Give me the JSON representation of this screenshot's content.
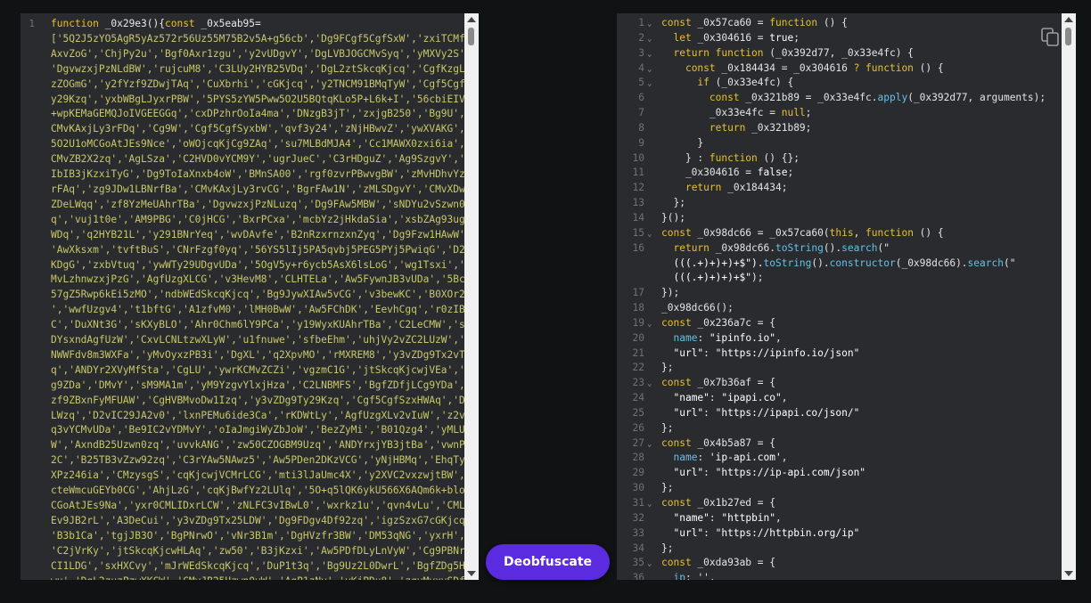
{
  "left_editor": {
    "line_number": "1",
    "lines": [
      "function _0x29e3(){const _0x5eab95=",
      "['5Q2J5zYO5AgR5yAz572r56Uz55M75B2v5A+g56cb','Dg9FCgf5CgfSxW','zxiTCMfK",
      "AxvZoG','ChjPy2u','Bgf0Axr1zgu','y2vUDgvY','DgLVBJOGCMvSyq','yMXVy2S'",
      "'DgvwzxjPzNLdBW','rujcuM8','C3LUy2HYB25VDq','DgL2ztSkcqKjcq','CgfKzgLU",
      "zZOGmG','y2fYzf9ZDwjTAq','CuXbrhi','cGKjcq','y2TNCM91BMqTyW','Cgf5CgfS",
      "y29Kzq','yxbWBgLJyxrPBW','5PYS5zYW5Pww5O2U5BQtqKLo5P+L6k+I','56cbiEIVT",
      "+wpKEMaGEMQJoIVGEEGGq','cxDPzhrOoIa4ma','DNzgB3jT','zxjgB250','Bg9U',",
      "CMvKAxjLy3rFDq','Cg9W','Cgf5CgfSyxbW','qvf3y24','zNjHBwvZ','ywXVAKG',",
      "5O2U1oMCGoAtJEs9Nce','oWOjcqKjCg9ZAq','su7MLBdMJA4','Cc1MAWX0zxi6ia','",
      "CMvZB2X2zq','AgLSza','C2HVD0vYCM9Y','ugrJueC','C3rHDguZ','Ag9SzgvY','o",
      "IbIB3jKzxiTyG','Dg9ToIaXnxb4oW','BMnSA00','rgf0zvrPBwvgBW','zMvHDhvYzw",
      "rFAq','zg9JDw1LBNrfBa','CMvKAxjLy3rvCG','BgrFAw1N','zMLSDgvY','CMvXDwv",
      "ZDeLWqq','zf8YzMeUAhrTBa','DgvwzxjPzNLuzq','Dg9FAw5MBW','sNDYu2vSzwn0z",
      "q','vuj1t0e','AM9PBG','C0jHCG','BxrPCxa','mcbYz2jHkdaSia','xsbZAg93ug9",
      "WDq','q2HYB21L','y291BNrYeq','wvDAvfe','B2nRzxrnzxnZyq','Dg9Fzw1HAwW',",
      "'AwXksxm','tvftBuS','CNrFzgf0yq','56YS5lIj5PA5qvbj5PEG5PYj5PwiqG','D2L",
      "KDgG','zxbVtuq','ywWTy29UDgvUDa','5OgV5y+r6ycb5AsX6lsLoG','wg1Tsxi','B",
      "MvLzhnwzxjPzG','AgfUzgXLCG','v3HevM8','CLHTELa','Aw5FywnJB3vUDa','5Bcp",
      "57gZ5Rwp6kEi5zMO','ndbWEdSkcqKjcq','Bg9JywXIAw5vCG','v3bewKC','B0XOr2S",
      "','wwfUzgv4','t1bftG','A1zfvM0','lMH0BwW','Aw5FChDK','EevhCgq','r0zIBf",
      "C','DuXNt3G','sKXyBLO','Ahr0Chm6lY9PCa','y19WyxKUAhrTBa','C2LeCMW','sN",
      "DYsxndAgfUzW','CxvLCNLtzwXLyW','u1fnuwe','sfbeEhm','uhjVy2vZC2LUzW','m",
      "NWWFdv8m3WXFa','yMvOyxzPB3i','DgXL','q2XpvMO','rMXREM8','y3vZDg9Tx2vTy",
      "q','ANDYr2XVyMfSta','CgLU','ywrKCMvZCZi','vgzmC1G','jtSkcqKjcwjVEa','A",
      "g9ZDa','DMvY','sM9MA1m','yM9YzgvYlxjHza','C2LNBMFS','BgfZDfjLCg9YDa','",
      "zf9ZBxnFyMFUAW','CgHVBMvoDw1Izq','y3vZDg9Ty29Kzq','Cgf5CgfSzxHWAq','Dh",
      "LWzq','D2vIC29JA2v0','lxnPEMu6ide3Ca','rKDWtLy','AgfUzgXLv2vIuW','z2v0",
      "q3vYCMvUDa','Be9IC2vYDMvY','oIaJmgiWyZbJoW','BezZyMi','B01Qzg4','yMLUC",
      "W','AxndB25Uzwn0zq','uvvkANG','zw50CZOGBM9Uzq','ANDYrxjYB3jtBa','vwnPr",
      "2C','B25TB3vZzw92zq','C3rYAw5NAwz5','Aw5PDen2DKzVCG','yNjHBMq','EhqTyw",
      "XPz246ia','CMzysgS','cqKjcwjVCMrLCG','mti3lJaUmc4X','y2XVC2vxzwjtBW','",
      "cteWmcuGEYb0CG','AhjLzG','cqKjBwfYz2LUlq','5O+q5lQK6ykU566X6AQm6k+bloM",
      "CGoAtJEs9Na','yxr0CMLIDxrLCW','zNLFC3vIBwL0','wxrkz1u','qvn4vLu','CMLM",
      "Ev9JB2rL','A3DeCui','y3vZDg9Tx25LDW','Dg9FDgv4Df92zq','igzSzxG7cGKjcq',",
      "'B3b1Ca','tgjJB3O','BgPNrwO','vNr3B1m','DgHVzfr3BW','DM53qNG','yxrH',",
      "'C2jVrKy','jtSkcqKjcwHLAq','zw50','B3jKzxi','Aw5PDfDLyLnVyW','Cg9PBNrL",
      "CI1LDG','sxHXCvy','mJrWEdSkcqKjcq','DuP1t3q','Bg9Uz2L0DwrL','BgfZDg5HB",
      "wu','DgL2zuzPzwXKCW','CMvJB25Uzwn0vW','AgP1zNv','yKjPDu8','zgvMyxvSDfb"
    ]
  },
  "button": {
    "label": "Deobfuscate"
  },
  "right_editor": {
    "lines": [
      {
        "n": "1",
        "fold": true,
        "code": [
          [
            "k",
            "const "
          ],
          [
            "p",
            "_0x57ca60 = "
          ],
          [
            "k",
            "function"
          ],
          [
            "p",
            " () {"
          ]
        ]
      },
      {
        "n": "2",
        "fold": true,
        "code": [
          [
            "p",
            "  "
          ],
          [
            "k",
            "let "
          ],
          [
            "p",
            "_0x304616 = "
          ],
          [
            "s",
            "true"
          ],
          [
            "p",
            ";"
          ]
        ]
      },
      {
        "n": "3",
        "fold": true,
        "code": [
          [
            "p",
            "  "
          ],
          [
            "k",
            "return function"
          ],
          [
            "p",
            " (_0x392d77, _0x33e4fc) {"
          ]
        ]
      },
      {
        "n": "4",
        "fold": true,
        "code": [
          [
            "p",
            "    "
          ],
          [
            "k",
            "const "
          ],
          [
            "p",
            "_0x184434 = _0x304616 "
          ],
          [
            "k",
            "? function"
          ],
          [
            "p",
            " () {"
          ]
        ]
      },
      {
        "n": "5",
        "fold": true,
        "code": [
          [
            "p",
            "      "
          ],
          [
            "k",
            "if"
          ],
          [
            "p",
            " (_0x33e4fc) {"
          ]
        ]
      },
      {
        "n": "6",
        "fold": false,
        "code": [
          [
            "p",
            "        "
          ],
          [
            "k",
            "const "
          ],
          [
            "p",
            "_0x321b89 = _0x33e4fc."
          ],
          [
            "f",
            "apply"
          ],
          [
            "p",
            "(_0x392d77, arguments);"
          ]
        ]
      },
      {
        "n": "7",
        "fold": false,
        "code": [
          [
            "p",
            "        _0x33e4fc = "
          ],
          [
            "k",
            "null"
          ],
          [
            "p",
            ";"
          ]
        ]
      },
      {
        "n": "8",
        "fold": false,
        "code": [
          [
            "p",
            "        "
          ],
          [
            "k",
            "return "
          ],
          [
            "p",
            "_0x321b89;"
          ]
        ]
      },
      {
        "n": "9",
        "fold": false,
        "code": [
          [
            "p",
            "      }"
          ]
        ]
      },
      {
        "n": "10",
        "fold": false,
        "code": [
          [
            "p",
            "    } : "
          ],
          [
            "k",
            "function"
          ],
          [
            "p",
            " () {};"
          ]
        ]
      },
      {
        "n": "11",
        "fold": false,
        "code": [
          [
            "p",
            "    _0x304616 = "
          ],
          [
            "s",
            "false"
          ],
          [
            "p",
            ";"
          ]
        ]
      },
      {
        "n": "12",
        "fold": false,
        "code": [
          [
            "p",
            "    "
          ],
          [
            "k",
            "return "
          ],
          [
            "p",
            "_0x184434;"
          ]
        ]
      },
      {
        "n": "13",
        "fold": false,
        "code": [
          [
            "p",
            "  };"
          ]
        ]
      },
      {
        "n": "14",
        "fold": false,
        "code": [
          [
            "p",
            "}();"
          ]
        ]
      },
      {
        "n": "15",
        "fold": true,
        "code": [
          [
            "k",
            "const "
          ],
          [
            "p",
            "_0x98dc66 = _0x57ca60("
          ],
          [
            "k",
            "this"
          ],
          [
            "p",
            ", "
          ],
          [
            "k",
            "function"
          ],
          [
            "p",
            " () {"
          ]
        ]
      },
      {
        "n": "16",
        "fold": false,
        "code": [
          [
            "p",
            "  "
          ],
          [
            "k",
            "return "
          ],
          [
            "p",
            "_0x98dc66."
          ],
          [
            "f",
            "toString"
          ],
          [
            "p",
            "()."
          ],
          [
            "f",
            "search"
          ],
          [
            "p",
            "(\""
          ]
        ]
      },
      {
        "n": "",
        "fold": false,
        "code": [
          [
            "s",
            "  (((.+)+)+)+$\")."
          ],
          [
            "f",
            "toString"
          ],
          [
            "p",
            "()."
          ],
          [
            "f",
            "constructor"
          ],
          [
            "p",
            "(_0x98dc66)."
          ],
          [
            "f",
            "search"
          ],
          [
            "p",
            "(\""
          ]
        ]
      },
      {
        "n": "",
        "fold": false,
        "code": [
          [
            "s",
            "  (((.+)+)+)+$\""
          ],
          [
            "p",
            ");"
          ]
        ]
      },
      {
        "n": "17",
        "fold": false,
        "code": [
          [
            "p",
            "});"
          ]
        ]
      },
      {
        "n": "18",
        "fold": false,
        "code": [
          [
            "p",
            "_0x98dc66();"
          ]
        ]
      },
      {
        "n": "19",
        "fold": true,
        "code": [
          [
            "k",
            "const "
          ],
          [
            "p",
            "_0x236a7c = {"
          ]
        ]
      },
      {
        "n": "20",
        "fold": false,
        "code": [
          [
            "p",
            "  "
          ],
          [
            "f",
            "name"
          ],
          [
            "p",
            ": "
          ],
          [
            "s",
            "\"ipinfo.io\""
          ],
          [
            "p",
            ","
          ]
        ]
      },
      {
        "n": "21",
        "fold": false,
        "code": [
          [
            "p",
            "  "
          ],
          [
            "s",
            "\"url\""
          ],
          [
            "p",
            ": "
          ],
          [
            "s",
            "\"https://ipinfo.io/json\""
          ]
        ]
      },
      {
        "n": "22",
        "fold": false,
        "code": [
          [
            "p",
            "};"
          ]
        ]
      },
      {
        "n": "23",
        "fold": true,
        "code": [
          [
            "k",
            "const "
          ],
          [
            "p",
            "_0x7b36af = {"
          ]
        ]
      },
      {
        "n": "24",
        "fold": false,
        "code": [
          [
            "p",
            "  "
          ],
          [
            "s",
            "\"name\""
          ],
          [
            "p",
            ": "
          ],
          [
            "s",
            "\"ipapi.co\""
          ],
          [
            "p",
            ","
          ]
        ]
      },
      {
        "n": "25",
        "fold": false,
        "code": [
          [
            "p",
            "  "
          ],
          [
            "s",
            "\"url\""
          ],
          [
            "p",
            ": "
          ],
          [
            "s",
            "\"https://ipapi.co/json/\""
          ]
        ]
      },
      {
        "n": "26",
        "fold": false,
        "code": [
          [
            "p",
            "};"
          ]
        ]
      },
      {
        "n": "27",
        "fold": true,
        "code": [
          [
            "k",
            "const "
          ],
          [
            "p",
            "_0x4b5a87 = {"
          ]
        ]
      },
      {
        "n": "28",
        "fold": false,
        "code": [
          [
            "p",
            "  "
          ],
          [
            "f",
            "name"
          ],
          [
            "p",
            ": "
          ],
          [
            "s",
            "'ip-api.com'"
          ],
          [
            "p",
            ","
          ]
        ]
      },
      {
        "n": "29",
        "fold": false,
        "code": [
          [
            "p",
            "  "
          ],
          [
            "s",
            "\"url\""
          ],
          [
            "p",
            ": "
          ],
          [
            "s",
            "\"https://ip-api.com/json\""
          ]
        ]
      },
      {
        "n": "30",
        "fold": false,
        "code": [
          [
            "p",
            "};"
          ]
        ]
      },
      {
        "n": "31",
        "fold": true,
        "code": [
          [
            "k",
            "const "
          ],
          [
            "p",
            "_0x1b27ed = {"
          ]
        ]
      },
      {
        "n": "32",
        "fold": false,
        "code": [
          [
            "p",
            "  "
          ],
          [
            "s",
            "\"name\""
          ],
          [
            "p",
            ": "
          ],
          [
            "s",
            "\"httpbin\""
          ],
          [
            "p",
            ","
          ]
        ]
      },
      {
        "n": "33",
        "fold": false,
        "code": [
          [
            "p",
            "  "
          ],
          [
            "s",
            "\"url\""
          ],
          [
            "p",
            ": "
          ],
          [
            "s",
            "\"https://httpbin.org/ip\""
          ]
        ]
      },
      {
        "n": "34",
        "fold": false,
        "code": [
          [
            "p",
            "};"
          ]
        ]
      },
      {
        "n": "35",
        "fold": true,
        "code": [
          [
            "k",
            "const "
          ],
          [
            "p",
            "_0xda93ab = {"
          ]
        ]
      },
      {
        "n": "36",
        "fold": false,
        "code": [
          [
            "p",
            "  "
          ],
          [
            "f",
            "ip"
          ],
          [
            "p",
            ": '',"
          ]
        ]
      }
    ]
  },
  "colors": {
    "background": "#111214",
    "editor_bg": "#2a2b2e",
    "button": "#5b2be0",
    "keyword": "#e6c12f",
    "function": "#62c2e6",
    "string": "#ffffff"
  },
  "icons": {
    "copy": "copy-icon",
    "fold": "chevron-down-icon"
  }
}
